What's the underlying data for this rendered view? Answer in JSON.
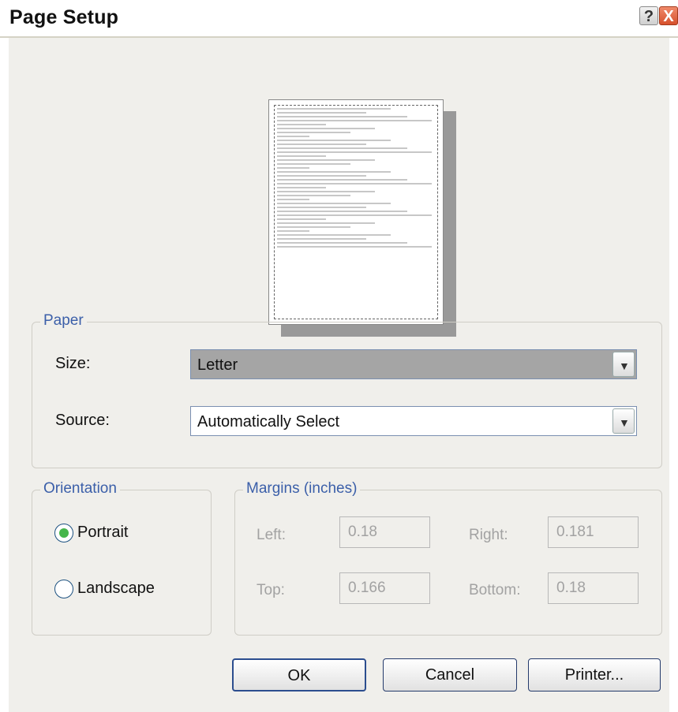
{
  "window": {
    "title": "Page Setup"
  },
  "titlebar": {
    "help_glyph": "?",
    "close_glyph": "X"
  },
  "paper": {
    "legend": "Paper",
    "size_label": "Size:",
    "size_value": "Letter",
    "source_label": "Source:",
    "source_value": "Automatically Select",
    "dropdown_icon": "chevron-down-icon"
  },
  "orientation": {
    "legend": "Orientation",
    "portrait_label": "Portrait",
    "landscape_label": "Landscape",
    "selected": "Portrait"
  },
  "margins": {
    "legend": "Margins (inches)",
    "left_label": "Left:",
    "left_value": "0.18",
    "right_label": "Right:",
    "right_value": "0.181",
    "top_label": "Top:",
    "top_value": "0.166",
    "bottom_label": "Bottom:",
    "bottom_value": "0.18"
  },
  "buttons": {
    "ok": "OK",
    "cancel": "Cancel",
    "printer": "Printer..."
  },
  "colors": {
    "accent": "#3b5fa9",
    "radio_selected": "#46b64b",
    "close": "#d6502c"
  }
}
